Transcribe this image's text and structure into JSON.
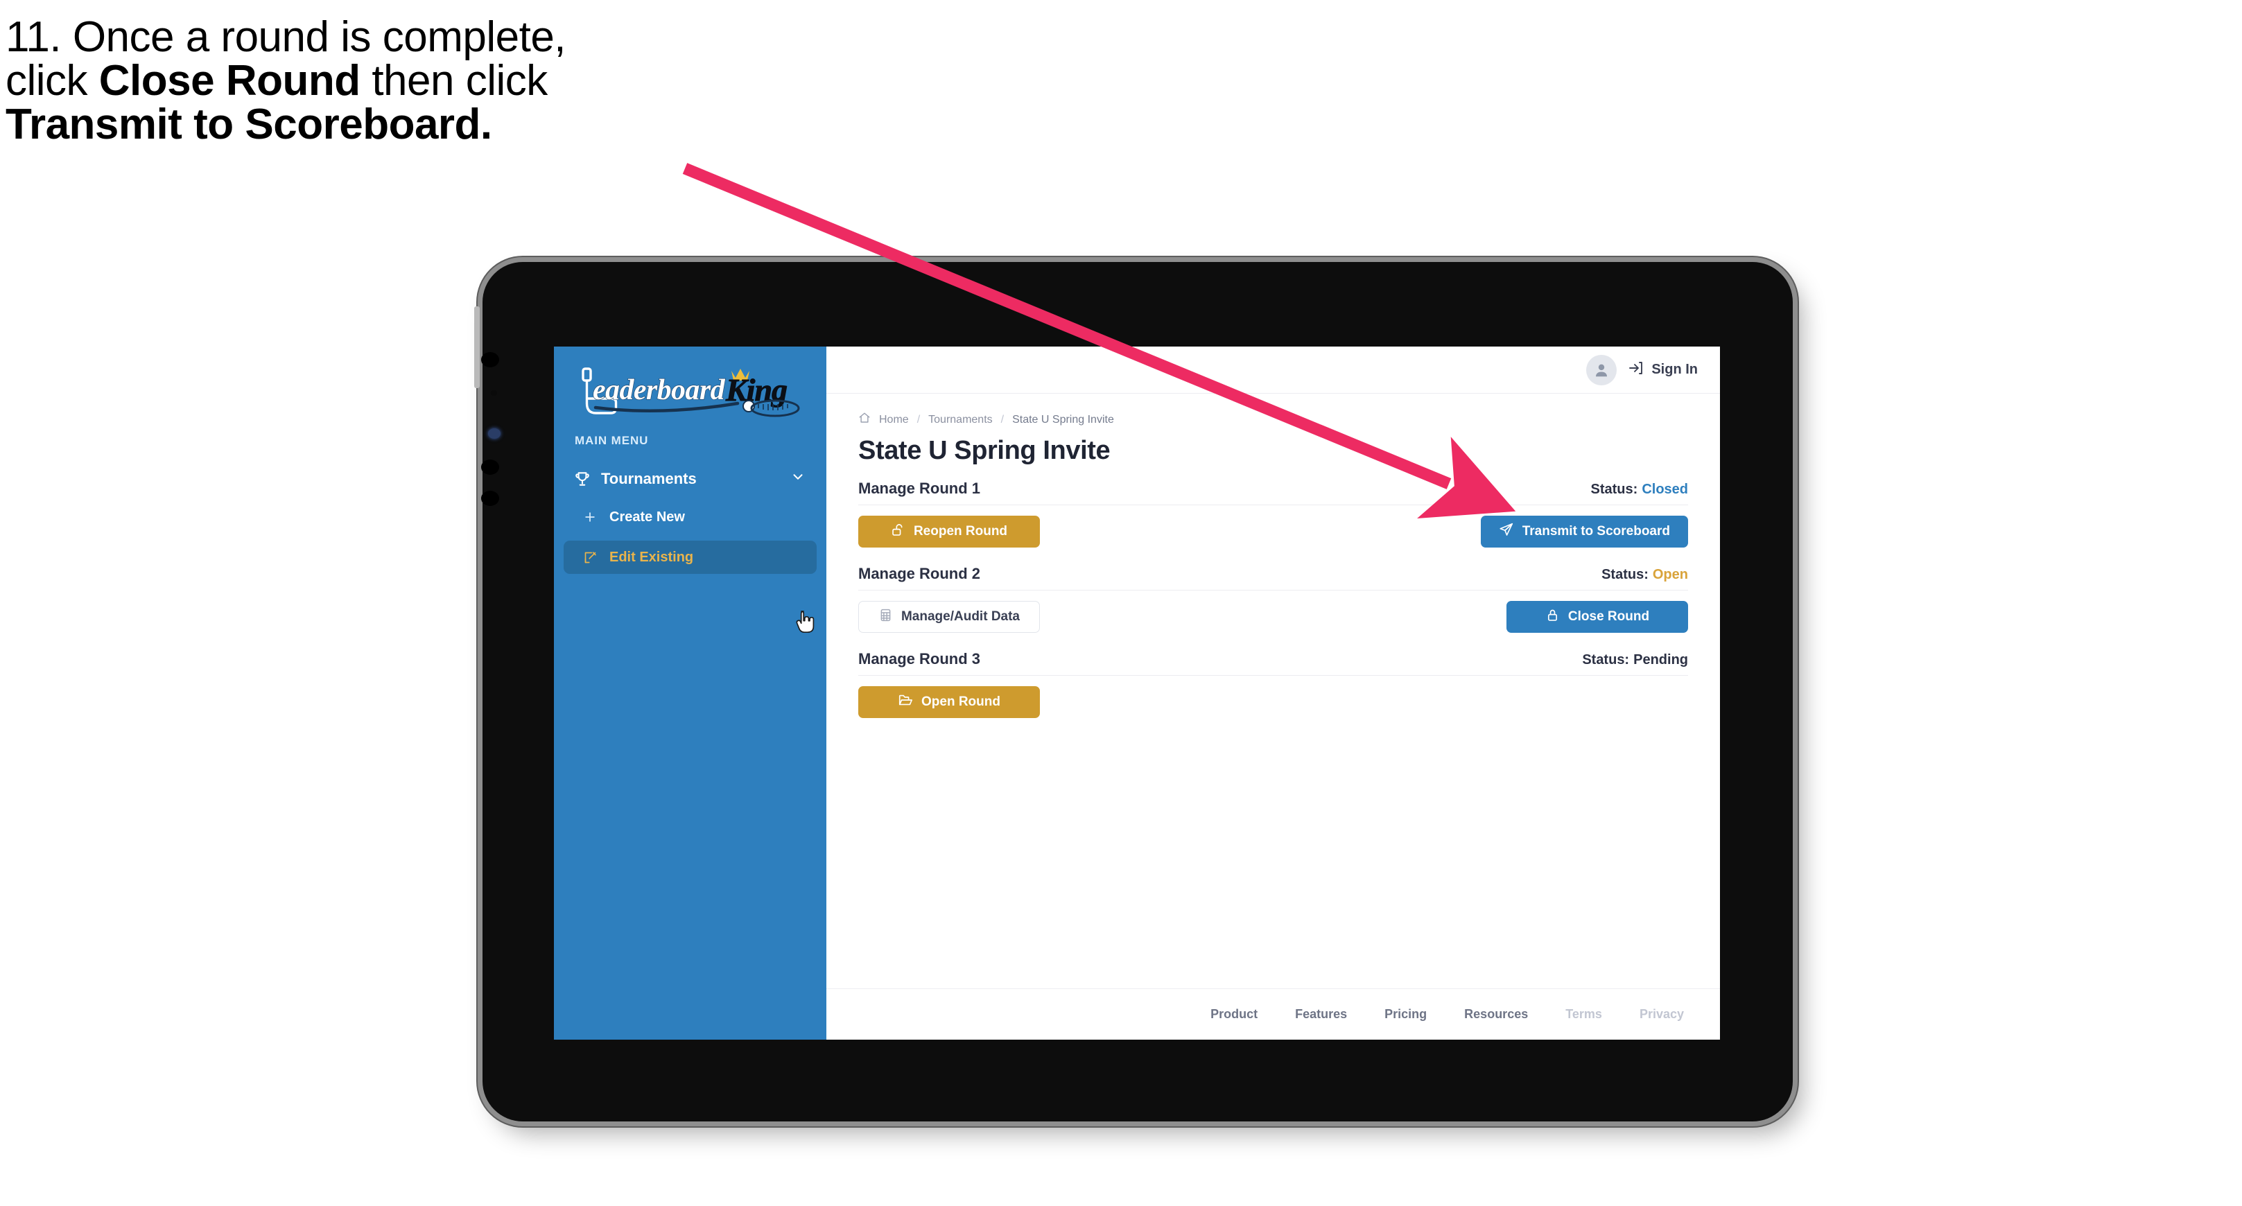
{
  "caption": {
    "lines": [
      [
        {
          "t": "11. Once a round is complete,",
          "b": false
        }
      ],
      [
        {
          "t": "click ",
          "b": false
        },
        {
          "t": "Close Round",
          "b": true
        },
        {
          "t": " then click",
          "b": false
        }
      ],
      [
        {
          "t": "Transmit to Scoreboard.",
          "b": true
        }
      ]
    ],
    "line1": "11. Once a round is complete,",
    "line2_pre": "click ",
    "line2_bold": "Close Round",
    "line2_post": " then click",
    "line3_bold": "Transmit to Scoreboard."
  },
  "brand": {
    "logo_text_primary": "Leaderboard",
    "logo_text_secondary": "King",
    "logo_icon": "golf-club-crown-logo",
    "accent_blue": "#2E7FBE",
    "accent_gold": "#CE9B2E",
    "active_gold_text": "#E9B44C",
    "sidebar_active_bg": "#266C9F"
  },
  "sidebar": {
    "section_label": "MAIN MENU",
    "nav": {
      "label": "Tournaments",
      "icon": "trophy-icon",
      "chevron": "chevron-down-icon"
    },
    "items": [
      {
        "label": "Create New",
        "icon": "plus-icon",
        "active": false
      },
      {
        "label": "Edit Existing",
        "icon": "edit-square-icon",
        "active": true
      }
    ]
  },
  "topbar": {
    "avatar_icon": "user-avatar-icon",
    "signin_icon": "sign-in-arrow-icon",
    "signin_label": "Sign In"
  },
  "breadcrumb": {
    "home_icon": "home-icon",
    "items": [
      "Home",
      "Tournaments",
      "State U Spring Invite"
    ],
    "separator": "/"
  },
  "main": {
    "page_title": "State U Spring Invite",
    "status_prefix": "Status:",
    "rounds": [
      {
        "name": "Manage Round 1",
        "status_value": "Closed",
        "status_class": "closed",
        "left_button": {
          "label": "Reopen Round",
          "style": "gold",
          "icon": "unlock-icon"
        },
        "right_button": {
          "label": "Transmit to Scoreboard",
          "style": "blue",
          "icon": "send-plane-icon"
        }
      },
      {
        "name": "Manage Round 2",
        "status_value": "Open",
        "status_class": "open",
        "left_button": {
          "label": "Manage/Audit Data",
          "style": "ghost",
          "icon": "grid-table-icon"
        },
        "right_button": {
          "label": "Close Round",
          "style": "blue",
          "icon": "lock-icon"
        }
      },
      {
        "name": "Manage Round 3",
        "status_value": "Pending",
        "status_class": "pending",
        "left_button": {
          "label": "Open Round",
          "style": "gold",
          "icon": "open-folder-icon"
        },
        "right_button": null
      }
    ]
  },
  "footer": {
    "links": [
      {
        "label": "Product",
        "muted": false
      },
      {
        "label": "Features",
        "muted": false
      },
      {
        "label": "Pricing",
        "muted": false
      },
      {
        "label": "Resources",
        "muted": false
      },
      {
        "label": "Terms",
        "muted": true
      },
      {
        "label": "Privacy",
        "muted": true
      }
    ]
  },
  "annotation": {
    "arrow_color": "#ED2B62",
    "points_to": "Transmit to Scoreboard"
  },
  "cursor": {
    "type": "pointing-hand-cursor"
  }
}
